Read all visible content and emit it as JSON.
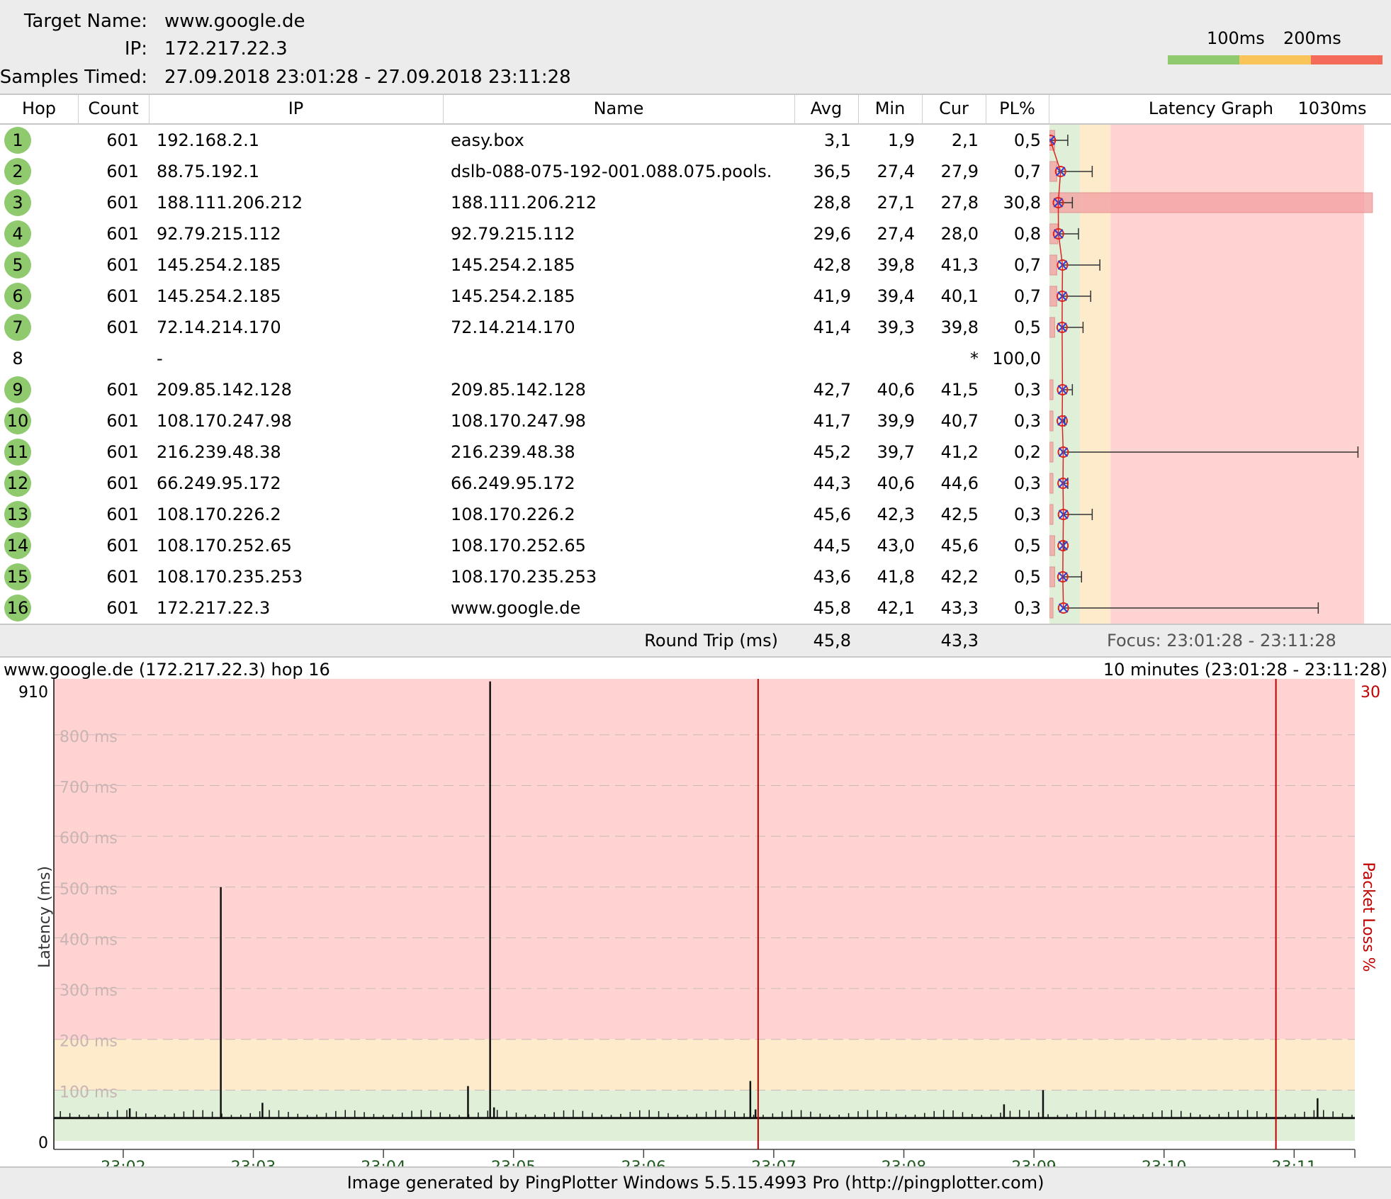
{
  "header": {
    "target_label": "Target Name:",
    "target_value": "www.google.de",
    "ip_label": "IP:",
    "ip_value": "172.217.22.3",
    "samples_label": "Samples Timed:",
    "samples_value": "27.09.2018 23:01:28 - 27.09.2018 23:11:28",
    "legend_100": "100ms",
    "legend_200": "200ms",
    "legend_colors": {
      "low": "#8fcb6e",
      "mid": "#f9c45a",
      "high": "#f46b5a"
    }
  },
  "columns": {
    "hop": "Hop",
    "count": "Count",
    "ip": "IP",
    "name": "Name",
    "avg": "Avg",
    "min": "Min",
    "cur": "Cur",
    "pl": "PL%",
    "graph": "Latency Graph",
    "graph_max": "1030ms"
  },
  "rows": [
    {
      "hop": "1",
      "count": "601",
      "ip": "192.168.2.1",
      "name": "easy.box",
      "avg": "3,1",
      "min": "1,9",
      "cur": "2,1",
      "pl": "0,5",
      "avg_ms": 3.1,
      "min_ms": 1.9,
      "max_ms": 60,
      "pl_pct": 0.5
    },
    {
      "hop": "2",
      "count": "601",
      "ip": "88.75.192.1",
      "name": "dslb-088-075-192-001.088.075.pools.",
      "avg": "36,5",
      "min": "27,4",
      "cur": "27,9",
      "pl": "0,7",
      "avg_ms": 36.5,
      "min_ms": 27.4,
      "max_ms": 140,
      "pl_pct": 0.7
    },
    {
      "hop": "3",
      "count": "601",
      "ip": "188.111.206.212",
      "name": "188.111.206.212",
      "avg": "28,8",
      "min": "27,1",
      "cur": "27,8",
      "pl": "30,8",
      "avg_ms": 28.8,
      "min_ms": 27.1,
      "max_ms": 75,
      "pl_pct": 30.8
    },
    {
      "hop": "4",
      "count": "601",
      "ip": "92.79.215.112",
      "name": "92.79.215.112",
      "avg": "29,6",
      "min": "27,4",
      "cur": "28,0",
      "pl": "0,8",
      "avg_ms": 29.6,
      "min_ms": 27.4,
      "max_ms": 95,
      "pl_pct": 0.8
    },
    {
      "hop": "5",
      "count": "601",
      "ip": "145.254.2.185",
      "name": "145.254.2.185",
      "avg": "42,8",
      "min": "39,8",
      "cur": "41,3",
      "pl": "0,7",
      "avg_ms": 42.8,
      "min_ms": 39.8,
      "max_ms": 165,
      "pl_pct": 0.7
    },
    {
      "hop": "6",
      "count": "601",
      "ip": "145.254.2.185",
      "name": "145.254.2.185",
      "avg": "41,9",
      "min": "39,4",
      "cur": "40,1",
      "pl": "0,7",
      "avg_ms": 41.9,
      "min_ms": 39.4,
      "max_ms": 135,
      "pl_pct": 0.7
    },
    {
      "hop": "7",
      "count": "601",
      "ip": "72.14.214.170",
      "name": "72.14.214.170",
      "avg": "41,4",
      "min": "39,3",
      "cur": "39,8",
      "pl": "0,5",
      "avg_ms": 41.4,
      "min_ms": 39.3,
      "max_ms": 110,
      "pl_pct": 0.5
    },
    {
      "hop": "8",
      "count": "",
      "ip": "-",
      "name": "",
      "avg": "",
      "min": "",
      "cur": "*",
      "pl": "100,0",
      "no_reply": true
    },
    {
      "hop": "9",
      "count": "601",
      "ip": "209.85.142.128",
      "name": "209.85.142.128",
      "avg": "42,7",
      "min": "40,6",
      "cur": "41,5",
      "pl": "0,3",
      "avg_ms": 42.7,
      "min_ms": 40.6,
      "max_ms": 75,
      "pl_pct": 0.3
    },
    {
      "hop": "10",
      "count": "601",
      "ip": "108.170.247.98",
      "name": "108.170.247.98",
      "avg": "41,7",
      "min": "39,9",
      "cur": "40,7",
      "pl": "0,3",
      "avg_ms": 41.7,
      "min_ms": 39.9,
      "max_ms": 50,
      "pl_pct": 0.3
    },
    {
      "hop": "11",
      "count": "601",
      "ip": "216.239.48.38",
      "name": "216.239.48.38",
      "avg": "45,2",
      "min": "39,7",
      "cur": "41,2",
      "pl": "0,2",
      "avg_ms": 45.2,
      "min_ms": 39.7,
      "max_ms": 1010,
      "pl_pct": 0.2
    },
    {
      "hop": "12",
      "count": "601",
      "ip": "66.249.95.172",
      "name": "66.249.95.172",
      "avg": "44,3",
      "min": "40,6",
      "cur": "44,6",
      "pl": "0,3",
      "avg_ms": 44.3,
      "min_ms": 40.6,
      "max_ms": 60,
      "pl_pct": 0.3
    },
    {
      "hop": "13",
      "count": "601",
      "ip": "108.170.226.2",
      "name": "108.170.226.2",
      "avg": "45,6",
      "min": "42,3",
      "cur": "42,5",
      "pl": "0,3",
      "avg_ms": 45.6,
      "min_ms": 42.3,
      "max_ms": 140,
      "pl_pct": 0.3
    },
    {
      "hop": "14",
      "count": "601",
      "ip": "108.170.252.65",
      "name": "108.170.252.65",
      "avg": "44,5",
      "min": "43,0",
      "cur": "45,6",
      "pl": "0,5",
      "avg_ms": 44.5,
      "min_ms": 43.0,
      "max_ms": 48,
      "pl_pct": 0.5
    },
    {
      "hop": "15",
      "count": "601",
      "ip": "108.170.235.253",
      "name": "108.170.235.253",
      "avg": "43,6",
      "min": "41,8",
      "cur": "42,2",
      "pl": "0,5",
      "avg_ms": 43.6,
      "min_ms": 41.8,
      "max_ms": 105,
      "pl_pct": 0.5
    },
    {
      "hop": "16",
      "count": "601",
      "ip": "172.217.22.3",
      "name": "www.google.de",
      "avg": "45,8",
      "min": "42,1",
      "cur": "43,3",
      "pl": "0,3",
      "avg_ms": 45.8,
      "min_ms": 42.1,
      "max_ms": 880,
      "pl_pct": 0.3
    }
  ],
  "round_trip": {
    "label": "Round Trip (ms)",
    "avg": "45,8",
    "cur": "43,3",
    "focus": "Focus: 23:01:28 - 23:11:28"
  },
  "chart_header": {
    "left": "www.google.de (172.217.22.3) hop 16",
    "right": "10 minutes (23:01:28 - 23:11:28)"
  },
  "chart_data": {
    "type": "line",
    "ylabel": "Latency (ms)",
    "y2label": "Packet Loss %",
    "ylim": [
      0,
      910
    ],
    "y2max_label": "30",
    "ymax_label": "910",
    "ymin_label": "0",
    "ytick_labels": [
      "100 ms",
      "200 ms",
      "300 ms",
      "400 ms",
      "500 ms",
      "600 ms",
      "700 ms",
      "800 ms"
    ],
    "ytick_values": [
      100,
      200,
      300,
      400,
      500,
      600,
      700,
      800
    ],
    "xticks": [
      "23:02",
      "23:03",
      "23:04",
      "23:05",
      "23:06",
      "23:07",
      "23:08",
      "23:09",
      "23:10",
      "23:11"
    ],
    "x_start_min": 1.4667,
    "x_end_min": 11.4667,
    "baseline_ms": 45,
    "spikes": [
      {
        "t": 2.05,
        "v": 64
      },
      {
        "t": 2.75,
        "v": 500
      },
      {
        "t": 3.07,
        "v": 75
      },
      {
        "t": 4.65,
        "v": 108
      },
      {
        "t": 4.82,
        "v": 905
      },
      {
        "t": 4.85,
        "v": 66
      },
      {
        "t": 6.82,
        "v": 118
      },
      {
        "t": 6.86,
        "v": 62
      },
      {
        "t": 8.77,
        "v": 72
      },
      {
        "t": 9.07,
        "v": 100
      },
      {
        "t": 11.18,
        "v": 84
      }
    ],
    "packet_loss_markers": [
      {
        "t": 6.88
      },
      {
        "t": 10.86
      }
    ],
    "zones": {
      "green_to": 100,
      "yellow_to": 200,
      "colors": {
        "green": "#e0f0d8",
        "yellow": "#fdebcc",
        "red": "#ffd3d1"
      }
    }
  },
  "footer": "Image generated by PingPlotter Windows 5.5.15.4993 Pro (http://pingplotter.com)"
}
